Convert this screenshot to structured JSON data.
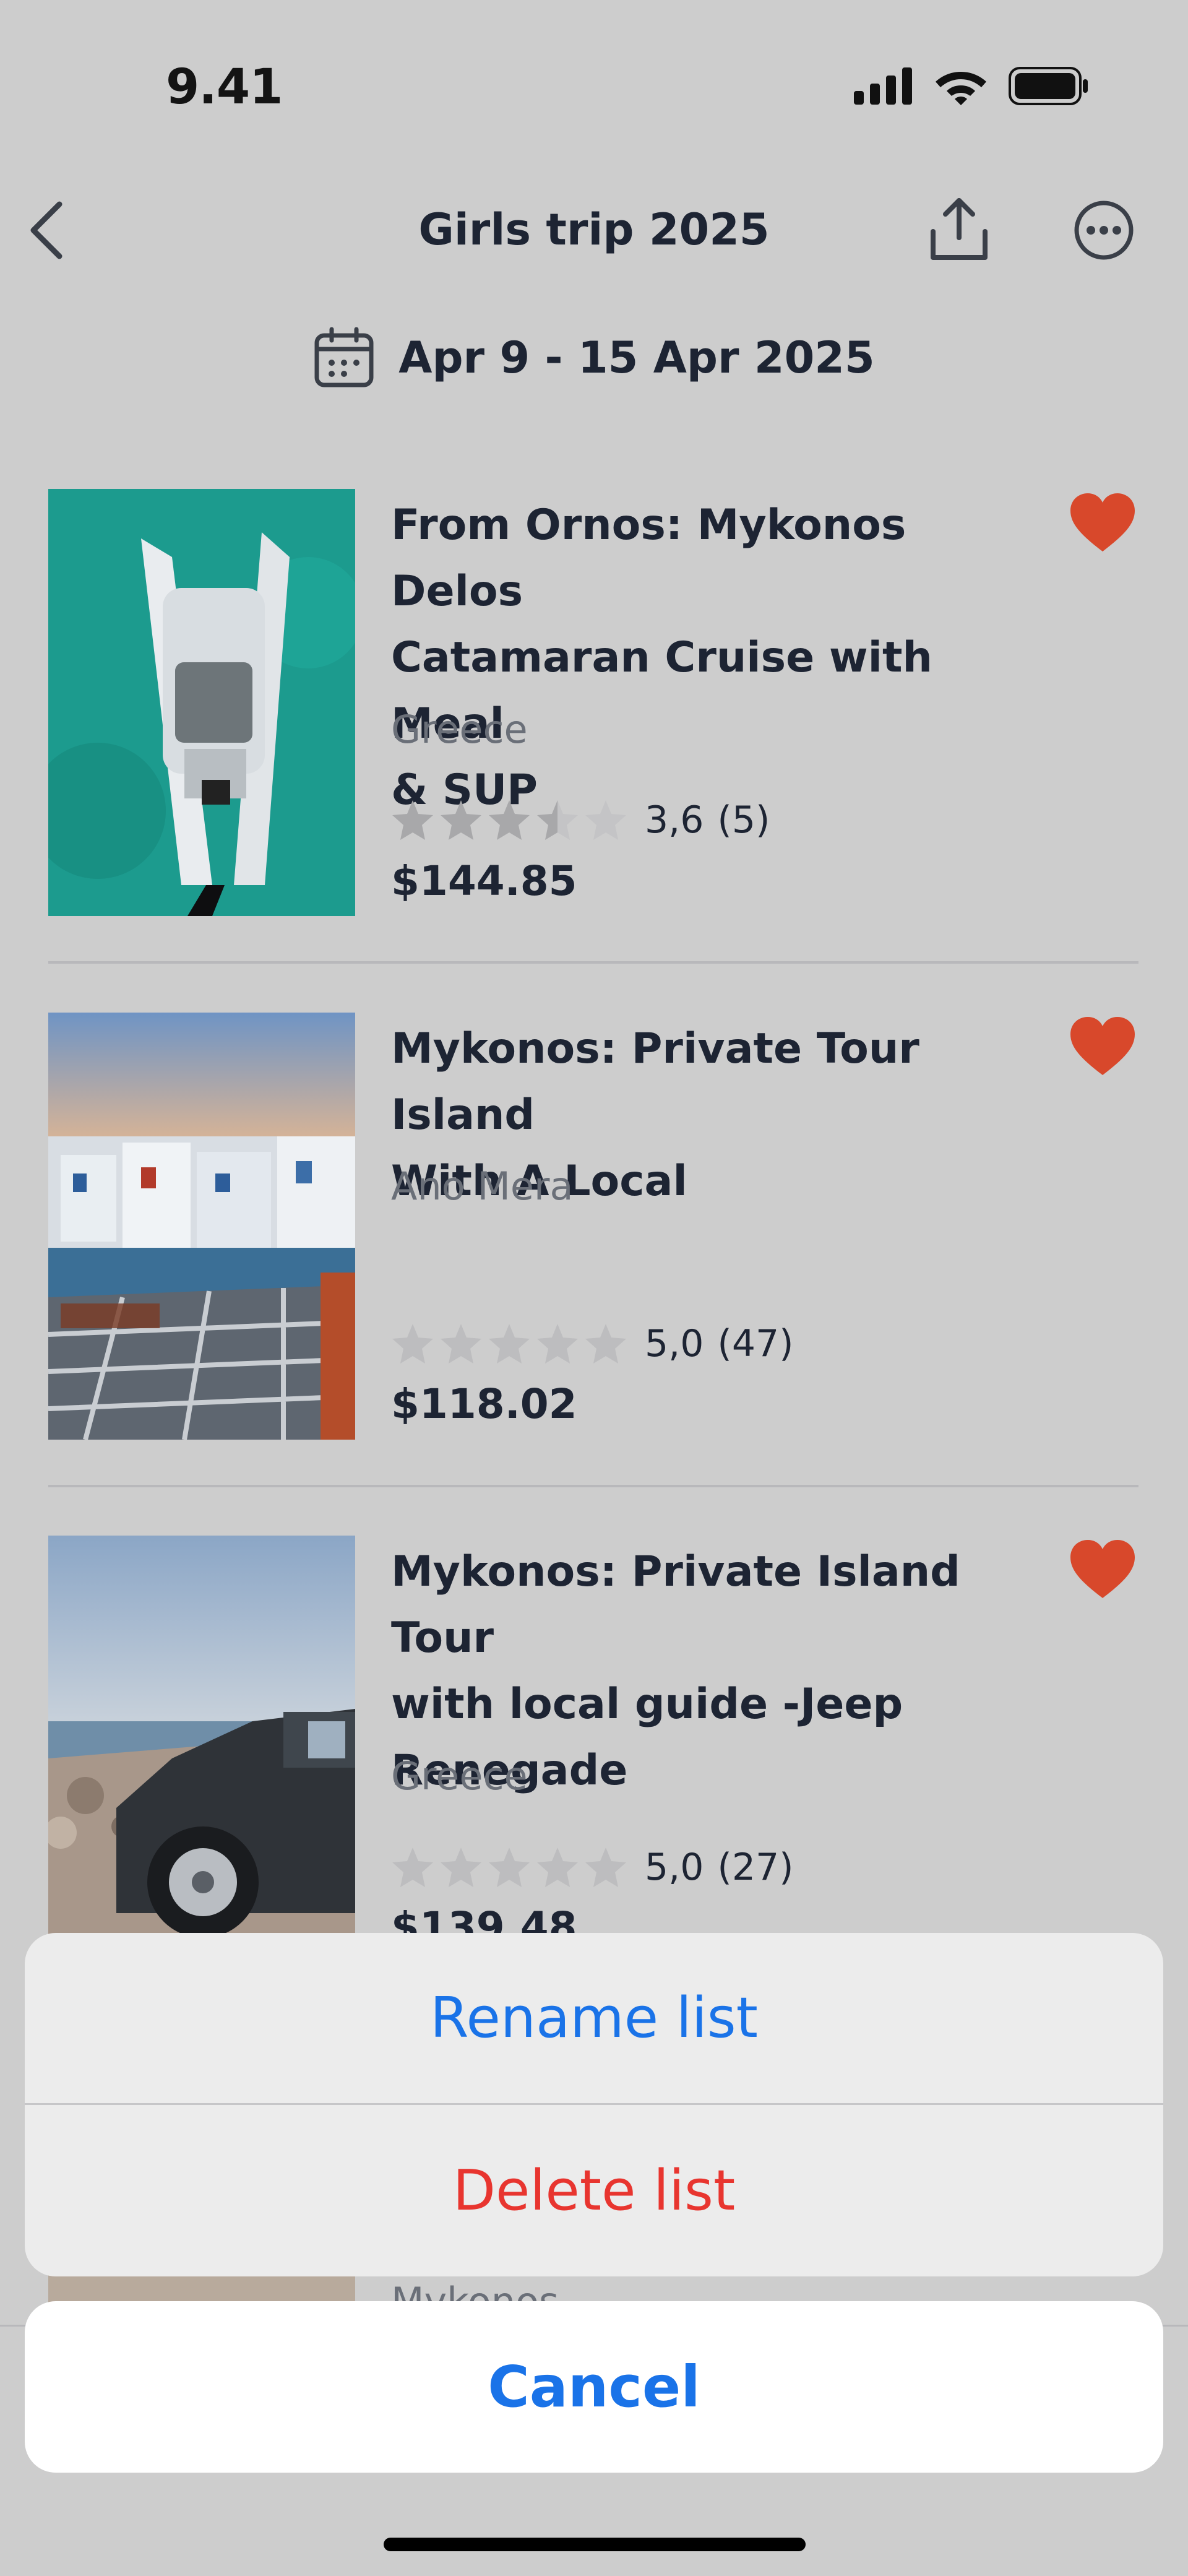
{
  "status_bar": {
    "time": "9.41"
  },
  "nav": {
    "title": "Girls trip 2025",
    "back_icon": "chevron-left-icon",
    "share_icon": "share-icon",
    "more_icon": "ellipsis-circle-icon"
  },
  "dates": {
    "label": "Apr 9 - 15 Apr 2025",
    "icon": "calendar-icon"
  },
  "colors": {
    "heart": "#d8482b",
    "blue_action": "#1a73e8",
    "destructive": "#e8352f",
    "star_empty": "#bdbdbf",
    "star_filled": "#a8a8aa"
  },
  "items": [
    {
      "title_lines": [
        "From Ornos: Mykonos Delos",
        "Catamaran Cruise with Meal",
        "& SUP"
      ],
      "location": "Greece",
      "rating": 3.6,
      "rating_label": "3,6",
      "reviews": "(5)",
      "price": "$144.85",
      "favorite": true
    },
    {
      "title_lines": [
        "Mykonos: Private Tour Island",
        "With A Local"
      ],
      "location": "Ano Mera",
      "rating": 5.0,
      "rating_label": "5,0",
      "reviews": "(47)",
      "price": "$118.02",
      "favorite": true
    },
    {
      "title_lines": [
        "Mykonos: Private Island Tour",
        "with local guide -Jeep",
        "Renegade"
      ],
      "location": "Greece",
      "rating": 5.0,
      "rating_label": "5,0",
      "reviews": "(27)",
      "price": "$139.48",
      "favorite": true
    },
    {
      "location": "Mykonos"
    }
  ],
  "action_sheet": {
    "rename": "Rename list",
    "delete": "Delete list",
    "cancel": "Cancel"
  }
}
